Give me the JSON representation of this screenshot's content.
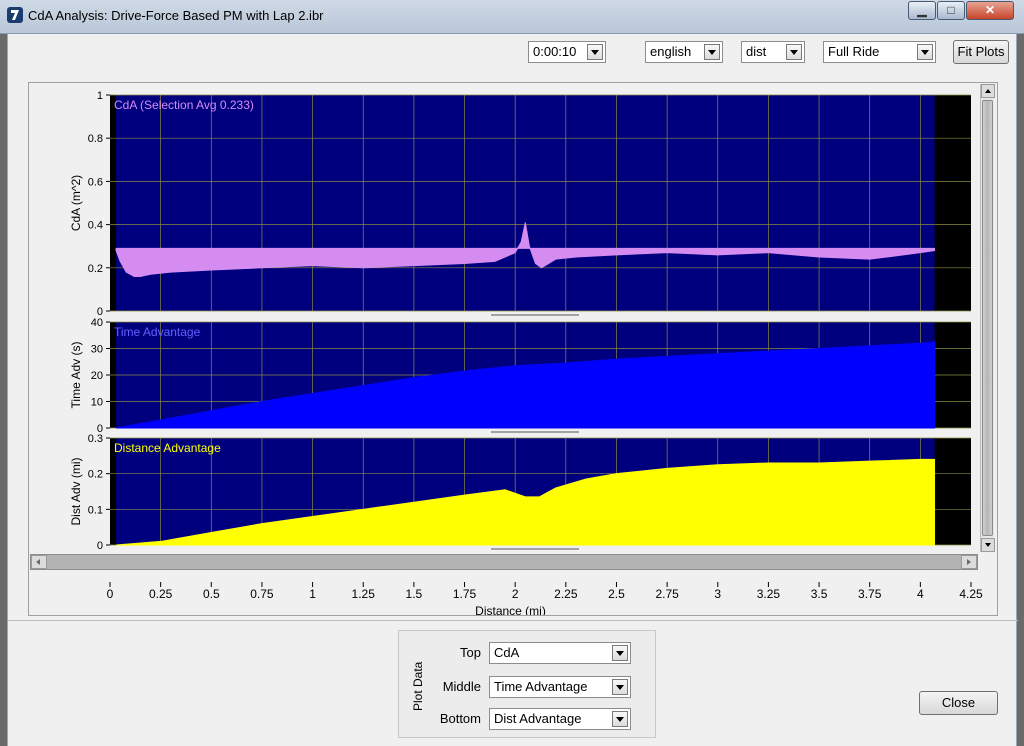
{
  "window": {
    "title": "CdA Analysis:  Drive-Force Based PM with Lap 2.ibr",
    "minimize": "▁",
    "maximize": "□",
    "close": "✕"
  },
  "toolbar": {
    "interval": "0:00:10",
    "units": "english",
    "xaxis_mode": "dist",
    "range": "Full Ride",
    "fit_plots_label": "Fit Plots"
  },
  "plot_data": {
    "group_label": "Plot Data",
    "top_label": "Top",
    "top_value": "CdA",
    "middle_label": "Middle",
    "middle_value": "Time Advantage",
    "bottom_label": "Bottom",
    "bottom_value": "Dist Advantage"
  },
  "close_label": "Close",
  "colors": {
    "plot_bg": "#00007f",
    "grid": "#8a8a40",
    "cda": "#d58cf0",
    "time_adv": "#0000ff",
    "dist_adv": "#ffff00",
    "time_title": "#6060ff"
  },
  "chart_data": [
    {
      "type": "area",
      "title": "CdA (Selection Avg 0.233)",
      "xlabel": "",
      "ylabel": "CdA (m^2)",
      "ylim": [
        0,
        1
      ],
      "yticks": [
        "0",
        "0.2",
        "0.4",
        "0.6",
        "0.8",
        "1"
      ],
      "baseline": 0.29,
      "x": [
        0.03,
        0.05,
        0.08,
        0.12,
        0.15,
        0.2,
        0.3,
        0.5,
        0.75,
        1.0,
        1.25,
        1.5,
        1.75,
        1.9,
        2.0,
        2.03,
        2.05,
        2.07,
        2.1,
        2.13,
        2.2,
        2.3,
        2.5,
        2.75,
        3.0,
        3.25,
        3.5,
        3.75,
        4.0,
        4.07
      ],
      "values": [
        0.28,
        0.23,
        0.18,
        0.16,
        0.16,
        0.17,
        0.18,
        0.19,
        0.2,
        0.21,
        0.2,
        0.21,
        0.22,
        0.23,
        0.27,
        0.32,
        0.41,
        0.3,
        0.22,
        0.2,
        0.24,
        0.25,
        0.26,
        0.27,
        0.26,
        0.27,
        0.25,
        0.24,
        0.27,
        0.28
      ],
      "grid": true
    },
    {
      "type": "area",
      "title": "Time Advantage",
      "xlabel": "",
      "ylabel": "Time Adv (s)",
      "ylim": [
        0,
        40
      ],
      "yticks": [
        "0",
        "10",
        "20",
        "30",
        "40"
      ],
      "x": [
        0.03,
        0.25,
        0.5,
        0.75,
        1.0,
        1.25,
        1.5,
        1.75,
        2.0,
        2.25,
        2.5,
        2.75,
        3.0,
        3.25,
        3.5,
        3.75,
        4.0,
        4.07
      ],
      "values": [
        0,
        3,
        6.5,
        10,
        13,
        16,
        19,
        21.5,
        23.5,
        24.5,
        26,
        27,
        28,
        29,
        30,
        31,
        32,
        32.5
      ],
      "grid": true
    },
    {
      "type": "area",
      "title": "Distance Advantage",
      "xlabel": "Distance (mi)",
      "ylabel": "Dist Adv (mi)",
      "ylim": [
        0,
        0.3
      ],
      "yticks": [
        "0",
        "0.1",
        "0.2",
        "0.3"
      ],
      "xticks": [
        "0",
        "0.25",
        "0.5",
        "0.75",
        "1",
        "1.25",
        "1.5",
        "1.75",
        "2",
        "2.25",
        "2.5",
        "2.75",
        "3",
        "3.25",
        "3.5",
        "3.75",
        "4",
        "4.25"
      ],
      "x": [
        0.03,
        0.25,
        0.5,
        0.75,
        1.0,
        1.25,
        1.5,
        1.75,
        1.95,
        2.05,
        2.12,
        2.2,
        2.35,
        2.5,
        2.75,
        3.0,
        3.25,
        3.5,
        3.75,
        4.0,
        4.07
      ],
      "values": [
        0,
        0.01,
        0.035,
        0.06,
        0.08,
        0.1,
        0.12,
        0.14,
        0.155,
        0.135,
        0.135,
        0.16,
        0.185,
        0.2,
        0.215,
        0.225,
        0.23,
        0.23,
        0.235,
        0.24,
        0.24
      ],
      "grid": true
    }
  ]
}
